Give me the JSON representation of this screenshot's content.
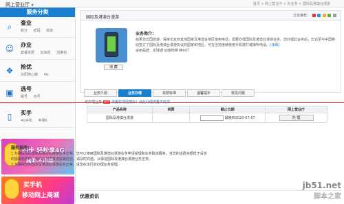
{
  "app": {
    "title": "网上营业厅",
    "breadcrumb": "首页 > 网上营业厅 > 办业务 > 国际及港澳台漫游"
  },
  "sidebar": {
    "header": "服务分类",
    "cats": [
      {
        "name": "查业",
        "icon": "search-icon",
        "subs": [
          "积分",
          "密码",
          "账单"
        ]
      },
      {
        "name": "办业",
        "icon": "user-icon",
        "subs": [
          "套餐资费",
          "加油包",
          "流量包"
        ]
      },
      {
        "name": "抢优",
        "icon": "gift-icon",
        "subs": [
          "沈阳随心聊",
          "4G"
        ]
      },
      {
        "name": "选号",
        "icon": "sim-icon",
        "subs": [
          "靓号",
          "吉号"
        ]
      },
      {
        "name": "买手",
        "icon": "phone-icon",
        "subs": [
          "4G手机",
          "苹果6"
        ]
      }
    ],
    "banner1": {
      "title": "四步 轻松享4G",
      "sub": "精彩不用等"
    },
    "banner2": {
      "title": "买手机",
      "sub": "移动网上商城"
    }
  },
  "card": {
    "title": "国际及港澳台漫游",
    "share_label": "分享推荐：",
    "intro_label": "业务简介：",
    "intro_text": "如果您出国旅游、探亲访友到其他国家及港澳台地区使用电话，需要办理国际及港澳台漫游业务。您办理此业务后，出访至与中国移动签订了国际及港澳台漫游协议的国家和地区，可在当地继续使用手机拨打或接听电话。",
    "detail_link": "[详细]",
    "users_text": "适用品牌：全球通 动感地带 神州行",
    "fav_button": "收 藏"
  },
  "tabs": [
    "业务介绍",
    "业务办理",
    "资费标准",
    "温馨提示",
    "常见问题"
  ],
  "active_tab": 1,
  "order": {
    "tip_pre": "可办理业务",
    "tip_hot": "HOT",
    "tip_link": "流量封顶便捷办！点此办理流量不封顶",
    "columns": [
      "产品名称",
      "资费",
      "截止日期",
      "网上营业厅"
    ],
    "rows": [
      {
        "name": "国际及港澳台漫游",
        "fee": "",
        "date_text": "最晚到2020-07-07",
        "action": "办 理"
      }
    ]
  },
  "description": {
    "header": "服务指南：",
    "lines": [
      "1.为确保您的国际及港澳台漫游业务正常，您可以使用国际及港澳台漫游业务申请受理和业务取消服务。当您的话费余额低于设定",
      "的提醒额度时，我们会为您发送提醒短信，请及时充值，以保证国际及港澳台漫游业务正常。",
      "2.为确保您的国际及港澳台漫游业务正常，请您在出行前办理业务受理。"
    ]
  },
  "preferred": "优惠资讯",
  "watermark": {
    "site": "jb51.net",
    "name": "脚本之家"
  }
}
